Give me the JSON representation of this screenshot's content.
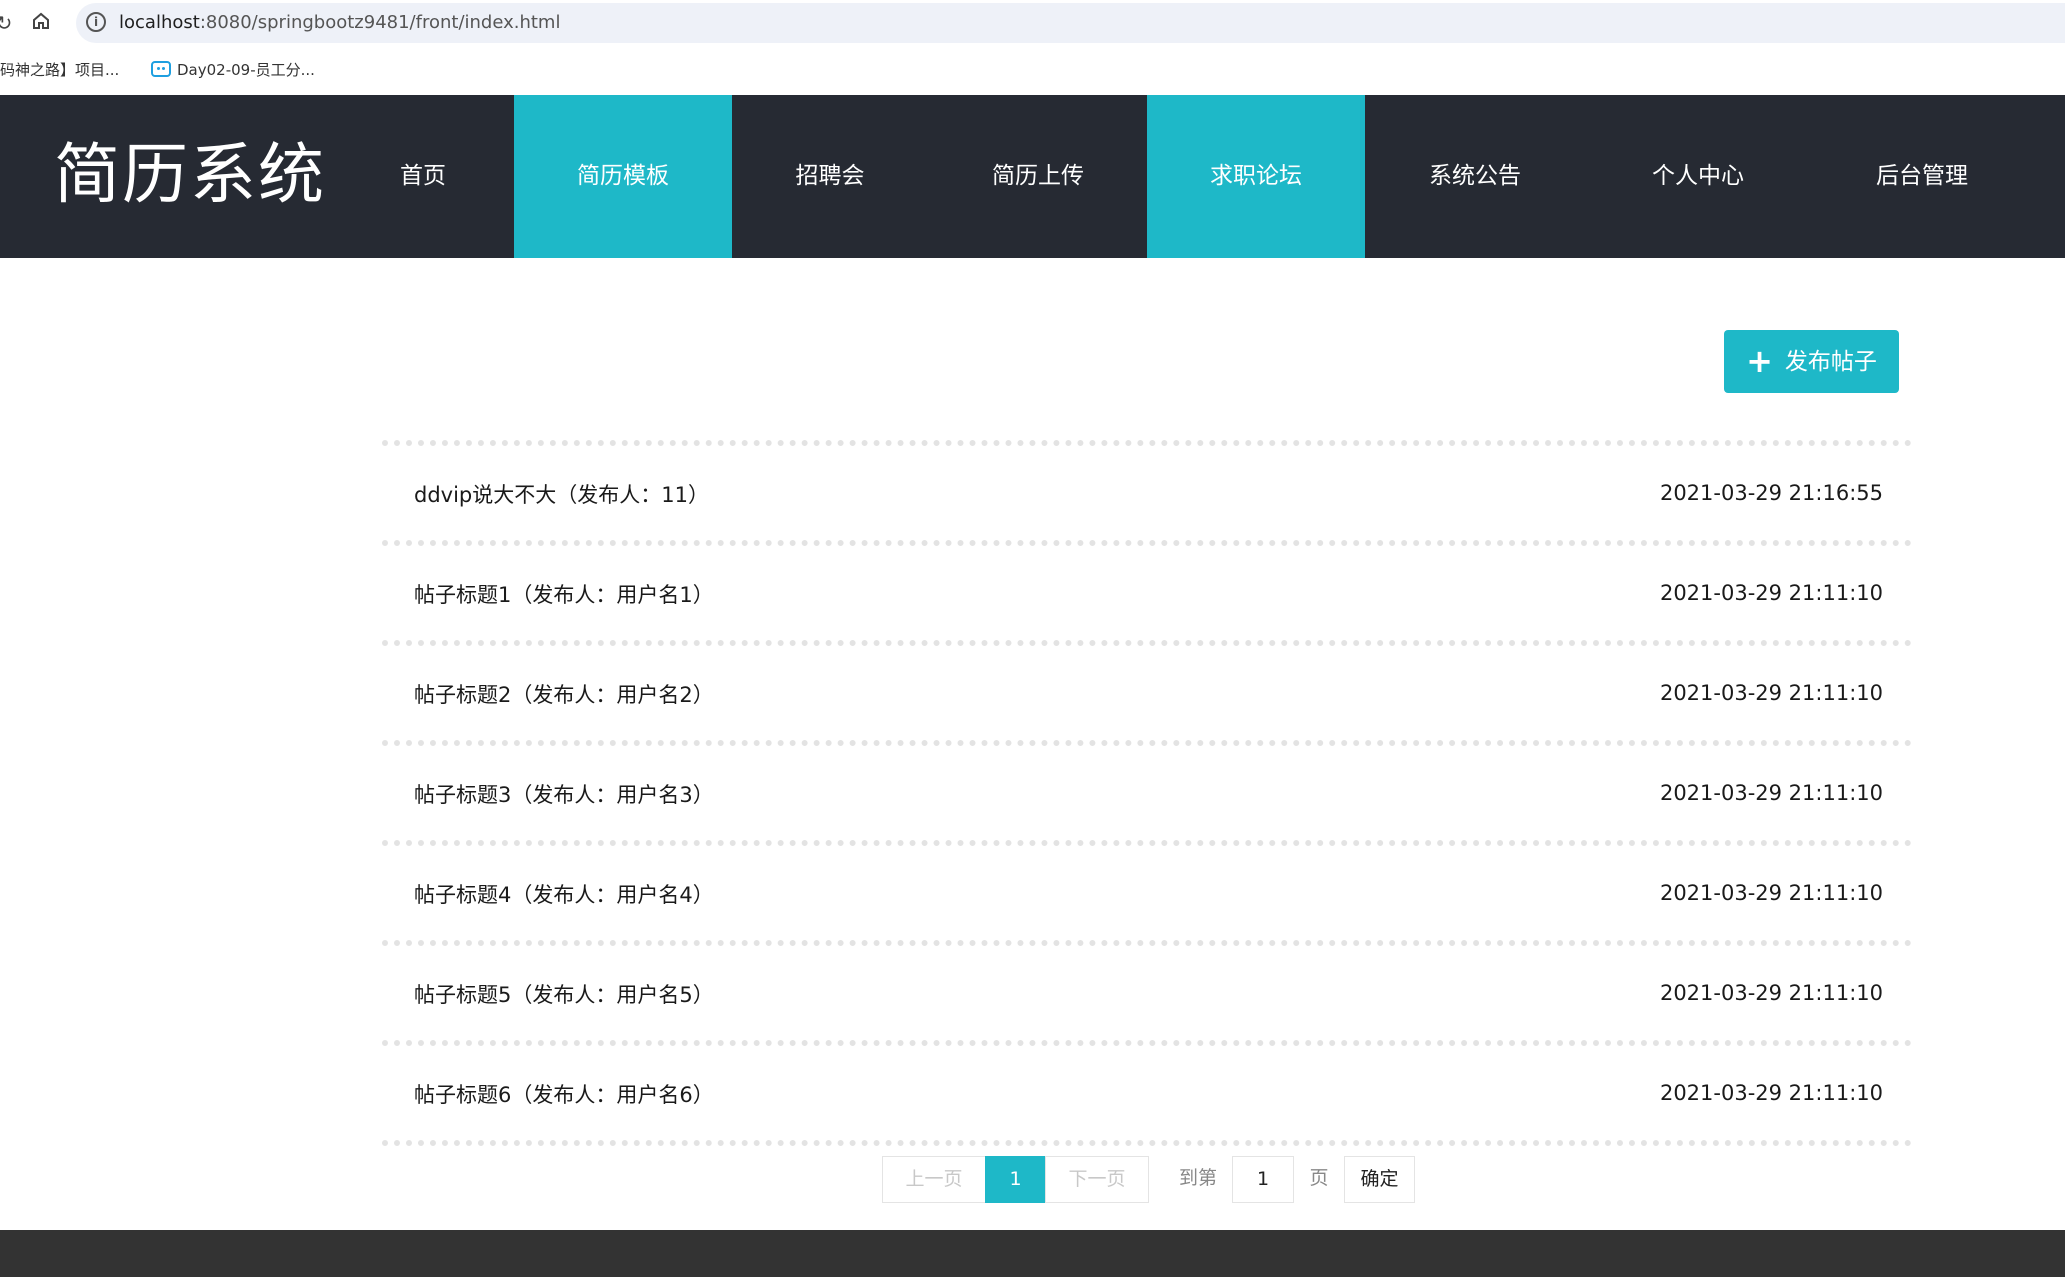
{
  "browser": {
    "url_host": "localhost",
    "url_rest": ":8080/springbootz9481/front/index.html",
    "bookmarks": [
      "码神之路】项目...",
      "Day02-09-员工分..."
    ]
  },
  "header": {
    "logo": "简历系统",
    "nav": [
      "首页",
      "简历模板",
      "招聘会",
      "简历上传",
      "求职论坛",
      "系统公告",
      "个人中心",
      "后台管理"
    ]
  },
  "toolbar": {
    "publish_label": "发布帖子",
    "publish_icon": "plus-icon"
  },
  "posts": [
    {
      "title": "ddvip说大不大（发布人：11）",
      "time": "2021-03-29 21:16:55"
    },
    {
      "title": "帖子标题1（发布人：用户名1）",
      "time": "2021-03-29 21:11:10"
    },
    {
      "title": "帖子标题2（发布人：用户名2）",
      "time": "2021-03-29 21:11:10"
    },
    {
      "title": "帖子标题3（发布人：用户名3）",
      "time": "2021-03-29 21:11:10"
    },
    {
      "title": "帖子标题4（发布人：用户名4）",
      "time": "2021-03-29 21:11:10"
    },
    {
      "title": "帖子标题5（发布人：用户名5）",
      "time": "2021-03-29 21:11:10"
    },
    {
      "title": "帖子标题6（发布人：用户名6）",
      "time": "2021-03-29 21:11:10"
    }
  ],
  "pagination": {
    "prev": "上一页",
    "current": "1",
    "next": "下一页",
    "goto_label": "到第",
    "page_input": "1",
    "page_suffix": "页",
    "confirm": "确定"
  },
  "colors": {
    "accent": "#1eb8c8",
    "header_bg": "#262a33",
    "footer_bg": "#333333"
  }
}
